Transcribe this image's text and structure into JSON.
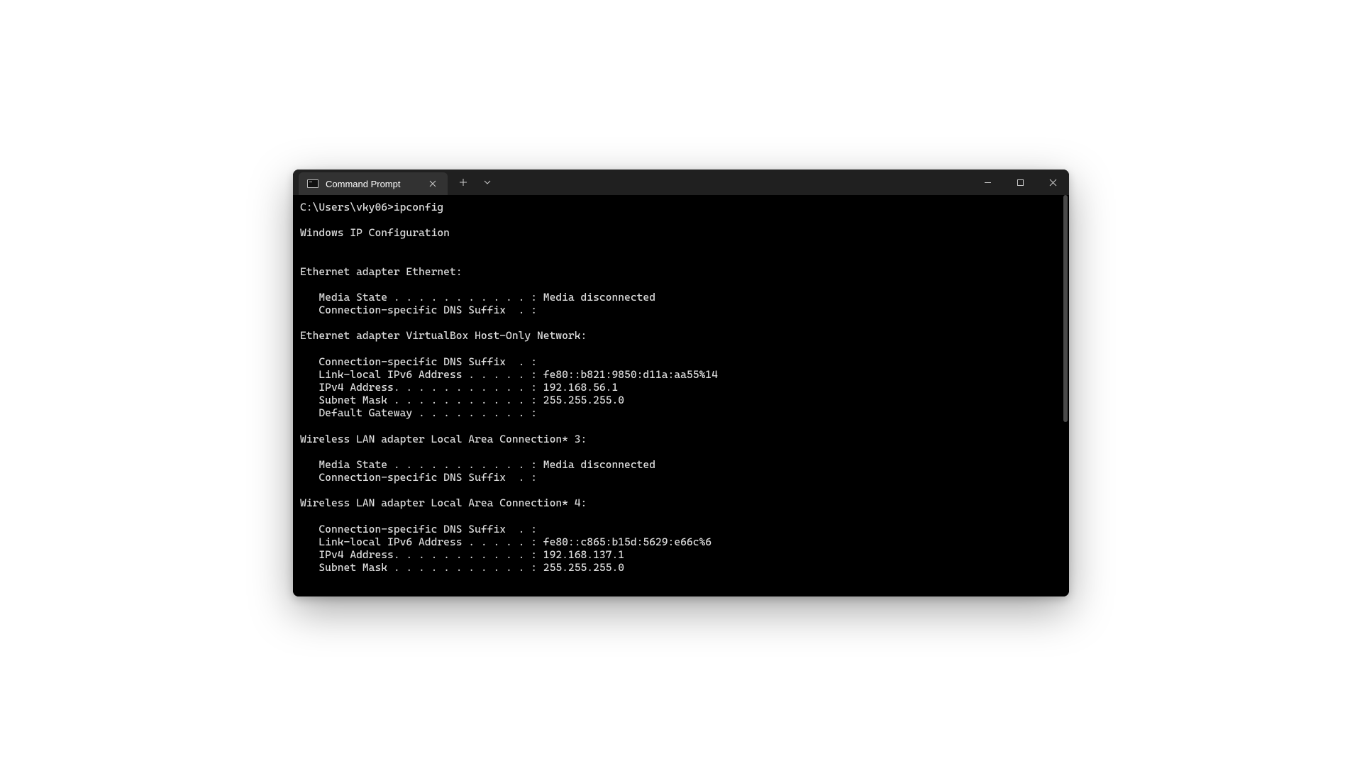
{
  "tab": {
    "title": "Command Prompt"
  },
  "terminal": {
    "lines": [
      "C:\\Users\\vky06>ipconfig",
      "",
      "Windows IP Configuration",
      "",
      "",
      "Ethernet adapter Ethernet:",
      "",
      "   Media State . . . . . . . . . . . : Media disconnected",
      "   Connection-specific DNS Suffix  . :",
      "",
      "Ethernet adapter VirtualBox Host-Only Network:",
      "",
      "   Connection-specific DNS Suffix  . :",
      "   Link-local IPv6 Address . . . . . : fe80::b821:9850:d11a:aa55%14",
      "   IPv4 Address. . . . . . . . . . . : 192.168.56.1",
      "   Subnet Mask . . . . . . . . . . . : 255.255.255.0",
      "   Default Gateway . . . . . . . . . :",
      "",
      "Wireless LAN adapter Local Area Connection* 3:",
      "",
      "   Media State . . . . . . . . . . . : Media disconnected",
      "   Connection-specific DNS Suffix  . :",
      "",
      "Wireless LAN adapter Local Area Connection* 4:",
      "",
      "   Connection-specific DNS Suffix  . :",
      "   Link-local IPv6 Address . . . . . : fe80::c865:b15d:5629:e66c%6",
      "   IPv4 Address. . . . . . . . . . . : 192.168.137.1",
      "   Subnet Mask . . . . . . . . . . . : 255.255.255.0"
    ]
  }
}
